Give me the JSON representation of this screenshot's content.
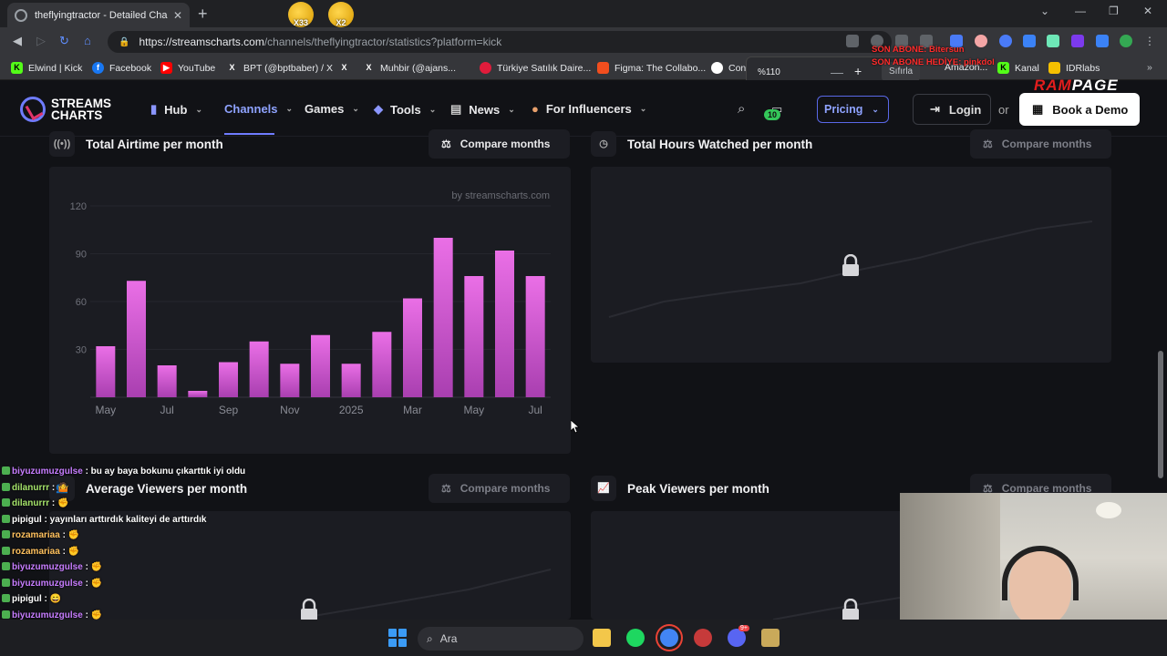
{
  "browser": {
    "tab_title": "theflyingtractor - Detailed Chan",
    "url_host": "https://streamscharts.com",
    "url_path": "/channels/theflyingtractor/statistics?platform=kick",
    "emotes": [
      {
        "label": "X33"
      },
      {
        "label": "X2"
      }
    ],
    "bookmarks": [
      {
        "label": "Elwind | Kick",
        "icon": "kick-icon",
        "color": "#53fc18"
      },
      {
        "label": "Facebook",
        "icon": "facebook-icon",
        "color": "#1877f2"
      },
      {
        "label": "YouTube",
        "icon": "youtube-icon",
        "color": "#ff0000"
      },
      {
        "label": "BPT (@bptbaber) / X",
        "icon": "x-icon",
        "color": "#000000"
      },
      {
        "label": "",
        "icon": "x-icon",
        "color": "#000000"
      },
      {
        "label": "Muhbir (@ajans...",
        "icon": "x-icon",
        "color": "#000000"
      },
      {
        "label": "Türkiye Satılık Daire...",
        "icon": "home-icon",
        "color": "#e01c3b"
      },
      {
        "label": "Figma: The Collabo...",
        "icon": "figma-icon",
        "color": "#f24e1e"
      },
      {
        "label": "Con",
        "icon": "chrome-icon",
        "color": "#ffffff"
      },
      {
        "label": "Amazon...",
        "icon": "amazon-icon",
        "color": "#ff9900"
      },
      {
        "label": "Kanal",
        "icon": "kick-icon",
        "color": "#53fc18"
      },
      {
        "label": "IDRlabs",
        "icon": "idrlabs-icon",
        "color": "#f5c000"
      }
    ],
    "zoom": {
      "value": "%110",
      "minus": "—",
      "plus": "+",
      "reset": "Sıfırla"
    }
  },
  "stream_overlay": {
    "alert_line1": "SON ABONE: Bitersun",
    "alert_line2": "SON ABONE HEDİYE: pinkdol",
    "brand_left": "RAM",
    "brand_right": "PAGE"
  },
  "site": {
    "logo_line1": "STREAMS",
    "logo_line2": "CHARTS",
    "nav": [
      {
        "label": "Hub",
        "icon": "bars-icon"
      },
      {
        "label": "Channels",
        "icon": ""
      },
      {
        "label": "Games",
        "icon": ""
      },
      {
        "label": "Tools",
        "icon": "diamond-icon"
      },
      {
        "label": "News",
        "icon": "newspaper-icon"
      },
      {
        "label": "For Influencers",
        "icon": "person-icon"
      }
    ],
    "badge_count": "10",
    "pricing_label": "Pricing",
    "login_label": "Login",
    "or_label": "or",
    "demo_label": "Book a Demo"
  },
  "sections": {
    "airtime": {
      "title": "Total Airtime per month",
      "compare": "Compare months"
    },
    "hours": {
      "title": "Total Hours Watched per month",
      "compare": "Compare months"
    },
    "avg": {
      "title": "Average Viewers per month",
      "compare": "Compare months"
    },
    "peak": {
      "title": "Peak Viewers per month",
      "compare": "Compare months"
    }
  },
  "chart_data": {
    "type": "bar",
    "title": "Total Airtime per month",
    "watermark": "by streamscharts.com",
    "categories": [
      "May",
      "Jun",
      "Jul",
      "Aug",
      "Sep",
      "Oct",
      "Nov",
      "Dec",
      "2025",
      "Feb",
      "Mar",
      "Apr",
      "May",
      "Jun",
      "Jul"
    ],
    "x_tick_labels": [
      "May",
      "Jul",
      "Sep",
      "Nov",
      "2025",
      "Mar",
      "May",
      "Jul"
    ],
    "x_tick_indices": [
      0,
      2,
      4,
      6,
      8,
      10,
      12,
      14
    ],
    "values": [
      32,
      73,
      20,
      4,
      22,
      35,
      21,
      39,
      21,
      41,
      62,
      100,
      76,
      92,
      76
    ],
    "y_ticks": [
      30,
      60,
      90,
      120
    ],
    "ylim": [
      0,
      120
    ],
    "grid": true,
    "bar_color_top": "#ea6fe6",
    "bar_color_bottom": "#a93fb0"
  },
  "chat": [
    {
      "user": "biyuzumuzgulse",
      "msg": ": bu ay baya bokunu çıkarttık iyi oldu",
      "color": "#c77dff"
    },
    {
      "user": "dilanurrr",
      "msg": ": 🤷",
      "color": "#a4e26a"
    },
    {
      "user": "dilanurrr",
      "msg": ": ✊",
      "color": "#a4e26a"
    },
    {
      "user": "pipigul",
      "msg": ": yayınları arttırdık kaliteyi de arttırdık",
      "color": "#ffffff"
    },
    {
      "user": "rozamariaa",
      "msg": ": ✊",
      "color": "#ffc15e"
    },
    {
      "user": "rozamariaa",
      "msg": ": ✊",
      "color": "#ffc15e"
    },
    {
      "user": "biyuzumuzgulse",
      "msg": ": ✊",
      "color": "#c77dff"
    },
    {
      "user": "biyuzumuzgulse",
      "msg": ": ✊",
      "color": "#c77dff"
    },
    {
      "user": "pipigul",
      "msg": ": 😄",
      "color": "#ffffff"
    },
    {
      "user": "biyuzumuzgulse",
      "msg": ": ✊",
      "color": "#c77dff"
    },
    {
      "user": "biyuzumuzgulse",
      "msg": ": ✊",
      "color": "#c77dff"
    }
  ],
  "taskbar": {
    "search_placeholder": "Ara",
    "discord_badge": "9+"
  }
}
